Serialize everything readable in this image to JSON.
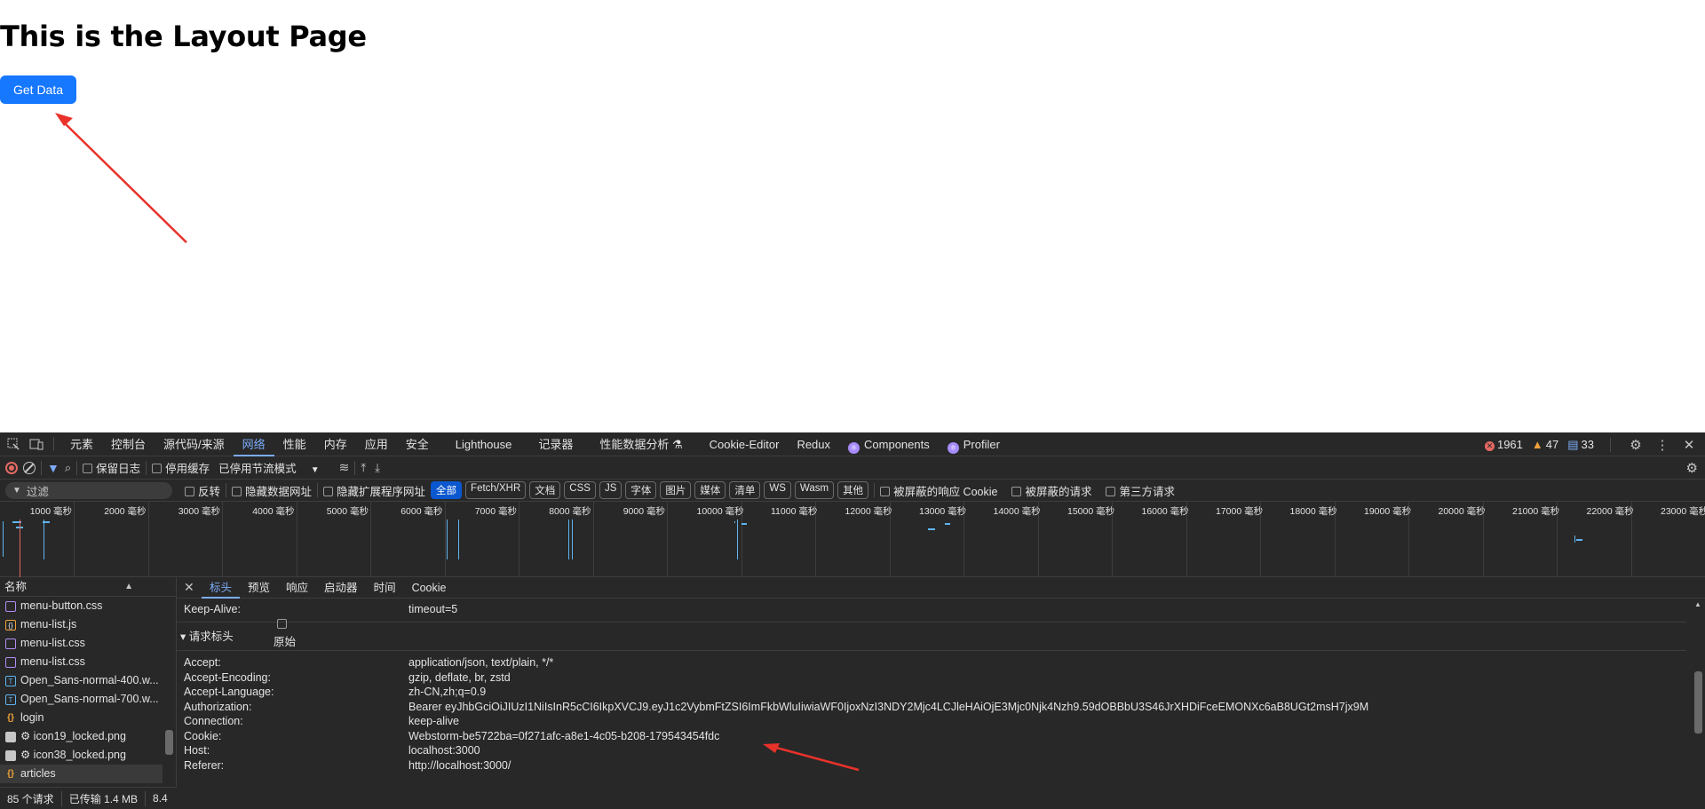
{
  "app": {
    "title": "This is the Layout Page",
    "button_label": "Get Data",
    "button_color": "#1677ff"
  },
  "devtools": {
    "tabs": [
      "元素",
      "控制台",
      "源代码/来源",
      "网络",
      "性能",
      "内存",
      "应用",
      "安全",
      "Lighthouse",
      "记录器",
      "性能数据分析",
      "Cookie-Editor",
      "Redux",
      "Components",
      "Profiler"
    ],
    "active_tab": "网络",
    "status": {
      "errors": "1961",
      "warnings": "47",
      "messages": "33"
    },
    "toolbar": {
      "preserve_log": "保留日志",
      "disable_cache": "停用缓存",
      "throttling": "已停用节流模式"
    },
    "filter": {
      "placeholder": "过滤",
      "invert": "反转",
      "hide_data_urls": "隐藏数据网址",
      "hide_ext_urls": "隐藏扩展程序网址",
      "types": [
        "全部",
        "Fetch/XHR",
        "文档",
        "CSS",
        "JS",
        "字体",
        "图片",
        "媒体",
        "清单",
        "WS",
        "Wasm",
        "其他"
      ],
      "active_type": "全部",
      "blocked_cookies": "被屏蔽的响应 Cookie",
      "blocked_requests": "被屏蔽的请求",
      "third_party": "第三方请求"
    },
    "timeline_ticks": [
      "1000 毫秒",
      "2000 毫秒",
      "3000 毫秒",
      "4000 毫秒",
      "5000 毫秒",
      "6000 毫秒",
      "7000 毫秒",
      "8000 毫秒",
      "9000 毫秒",
      "10000 毫秒",
      "11000 毫秒",
      "12000 毫秒",
      "13000 毫秒",
      "14000 毫秒",
      "15000 毫秒",
      "16000 毫秒",
      "17000 毫秒",
      "18000 毫秒",
      "19000 毫秒",
      "20000 毫秒",
      "21000 毫秒",
      "22000 毫秒",
      "23000 毫秒"
    ],
    "names_header": "名称",
    "files": [
      {
        "name": "menu-button.css",
        "type": "css"
      },
      {
        "name": "menu-list.js",
        "type": "js"
      },
      {
        "name": "menu-list.css",
        "type": "css"
      },
      {
        "name": "menu-list.css",
        "type": "css"
      },
      {
        "name": "Open_Sans-normal-400.w...",
        "type": "font"
      },
      {
        "name": "Open_Sans-normal-700.w...",
        "type": "font"
      },
      {
        "name": "login",
        "type": "xhr"
      },
      {
        "name": "⚙ icon19_locked.png",
        "type": "img"
      },
      {
        "name": "⚙ icon38_locked.png",
        "type": "img"
      },
      {
        "name": "articles",
        "type": "xhr"
      }
    ],
    "detail_tabs": [
      "标头",
      "预览",
      "响应",
      "启动器",
      "时间",
      "Cookie"
    ],
    "active_detail_tab": "标头",
    "keep_alive": {
      "key": "Keep-Alive:",
      "value": "timeout=5"
    },
    "request_headers_title": "▾ 请求标头",
    "raw_label": "原始",
    "headers": [
      {
        "key": "Accept:",
        "value": "application/json, text/plain, */*"
      },
      {
        "key": "Accept-Encoding:",
        "value": "gzip, deflate, br, zstd"
      },
      {
        "key": "Accept-Language:",
        "value": "zh-CN,zh;q=0.9"
      },
      {
        "key": "Authorization:",
        "value": "Bearer eyJhbGciOiJIUzI1NiIsInR5cCI6IkpXVCJ9.eyJ1c2VybmFtZSI6ImFkbWluIiwiaWF0IjoxNzI3NDY2Mjc4LCJleHAiOjE3Mjc0Njk4Nzh9.59dOBBbU3S46JrXHDiFceEMONXc6aB8UGt2msH7jx9M"
      },
      {
        "key": "Connection:",
        "value": "keep-alive"
      },
      {
        "key": "Cookie:",
        "value": "Webstorm-be5722ba=0f271afc-a8e1-4c05-b208-179543454fdc"
      },
      {
        "key": "Host:",
        "value": "localhost:3000"
      },
      {
        "key": "Referer:",
        "value": "http://localhost:3000/"
      }
    ],
    "statusbar": {
      "requests": "85 个请求",
      "transferred": "已传输 1.4 MB",
      "resources": "8.4"
    },
    "accent_color": "#7cacf8",
    "arrow_color": "#e8322a"
  }
}
